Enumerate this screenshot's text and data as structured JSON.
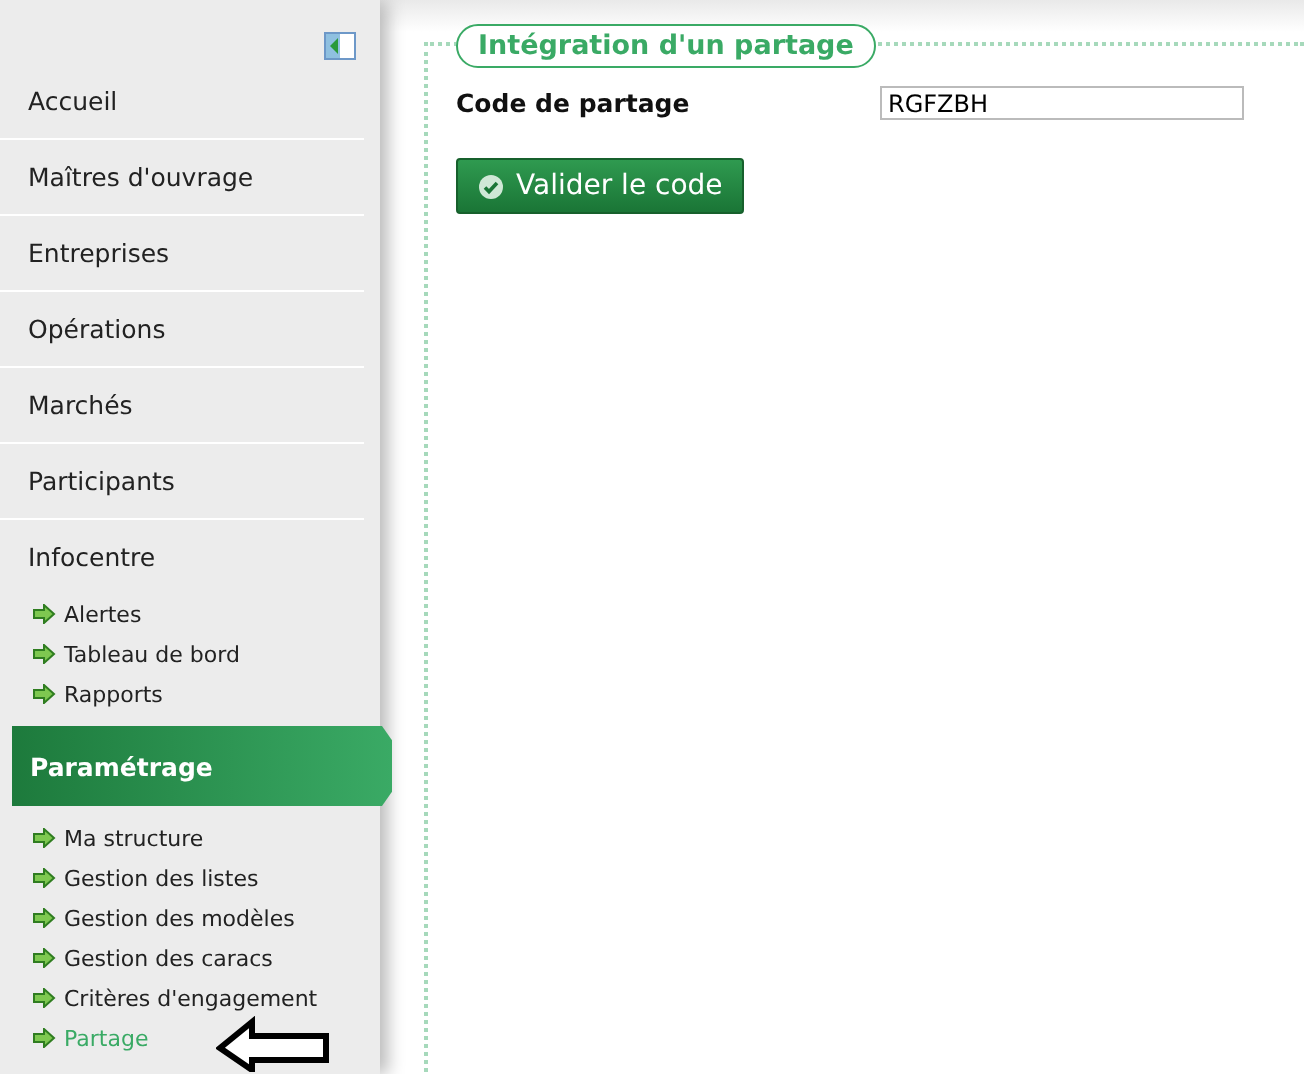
{
  "sidebar": {
    "items": [
      {
        "kind": "main",
        "label": "Accueil",
        "selected": false
      },
      {
        "kind": "main",
        "label": "Maîtres d'ouvrage",
        "selected": false
      },
      {
        "kind": "main",
        "label": "Entreprises",
        "selected": false
      },
      {
        "kind": "main",
        "label": "Opérations",
        "selected": false
      },
      {
        "kind": "main",
        "label": "Marchés",
        "selected": false
      },
      {
        "kind": "main",
        "label": "Participants",
        "selected": false
      },
      {
        "kind": "group",
        "label": "Infocentre",
        "selected": false
      },
      {
        "kind": "sub",
        "label": "Alertes",
        "selected": false
      },
      {
        "kind": "sub",
        "label": "Tableau de bord",
        "selected": false
      },
      {
        "kind": "sub",
        "label": "Rapports",
        "selected": false
      },
      {
        "kind": "group",
        "label": "Paramétrage",
        "selected": true
      },
      {
        "kind": "sub",
        "label": "Ma structure",
        "selected": false
      },
      {
        "kind": "sub",
        "label": "Gestion des listes",
        "selected": false
      },
      {
        "kind": "sub",
        "label": "Gestion des modèles",
        "selected": false
      },
      {
        "kind": "sub",
        "label": "Gestion des caracs",
        "selected": false
      },
      {
        "kind": "sub",
        "label": "Critères d'engagement",
        "selected": false
      },
      {
        "kind": "sub",
        "label": "Partage",
        "selected": true
      }
    ]
  },
  "panel": {
    "legend": "Intégration d'un partage",
    "field_label": "Code de partage",
    "field_value": "RGFZBH",
    "button": "Valider le code"
  }
}
